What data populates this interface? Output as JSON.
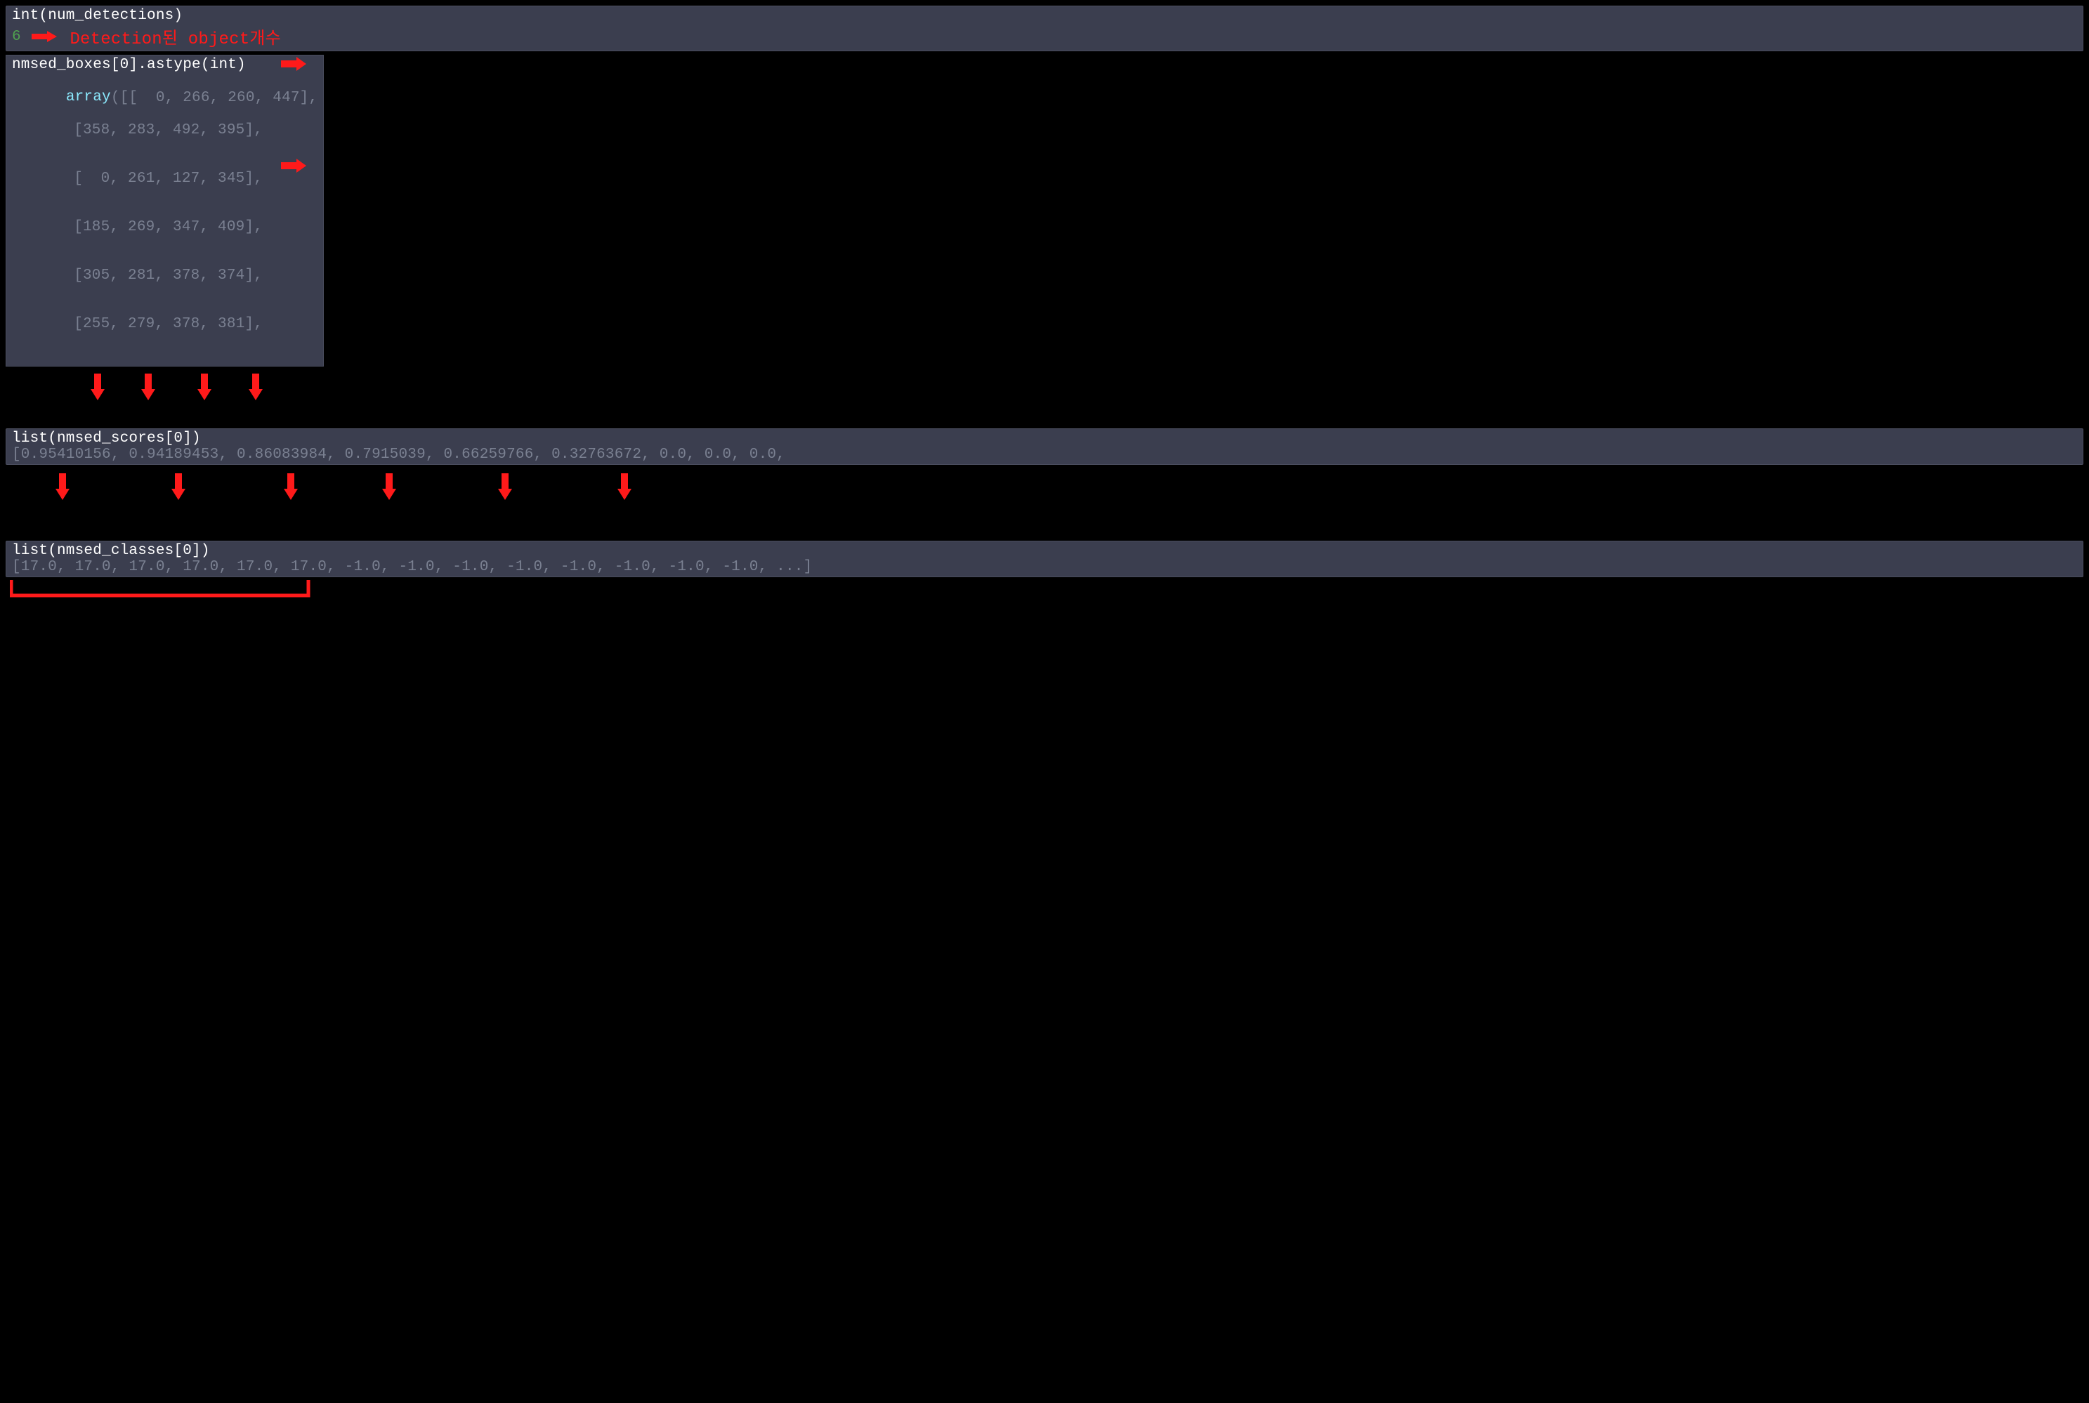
{
  "section1": {
    "code": "int(num_detections)",
    "output_value": "6",
    "annotation": "Detection된 object개수"
  },
  "section2": {
    "code": "nmsed_boxes[0].astype(int)",
    "output_prefix": "array",
    "rows": [
      "([[  0, 266, 260, 447],",
      "[358, 283, 492, 395],",
      "[  0, 261, 127, 345],",
      "[185, 269, 347, 409],",
      "[305, 281, 378, 374],",
      "[255, 279, 378, 381],"
    ]
  },
  "section3": {
    "code": "list(nmsed_scores[0])",
    "output": "[0.95410156, 0.94189453, 0.86083984, 0.7915039, 0.66259766, 0.32763672, 0.0, 0.0, 0.0,"
  },
  "section4": {
    "code": "list(nmsed_classes[0])",
    "output": "[17.0, 17.0, 17.0, 17.0, 17.0, 17.0, -1.0, -1.0, -1.0, -1.0, -1.0, -1.0, -1.0, -1.0, ...]"
  }
}
